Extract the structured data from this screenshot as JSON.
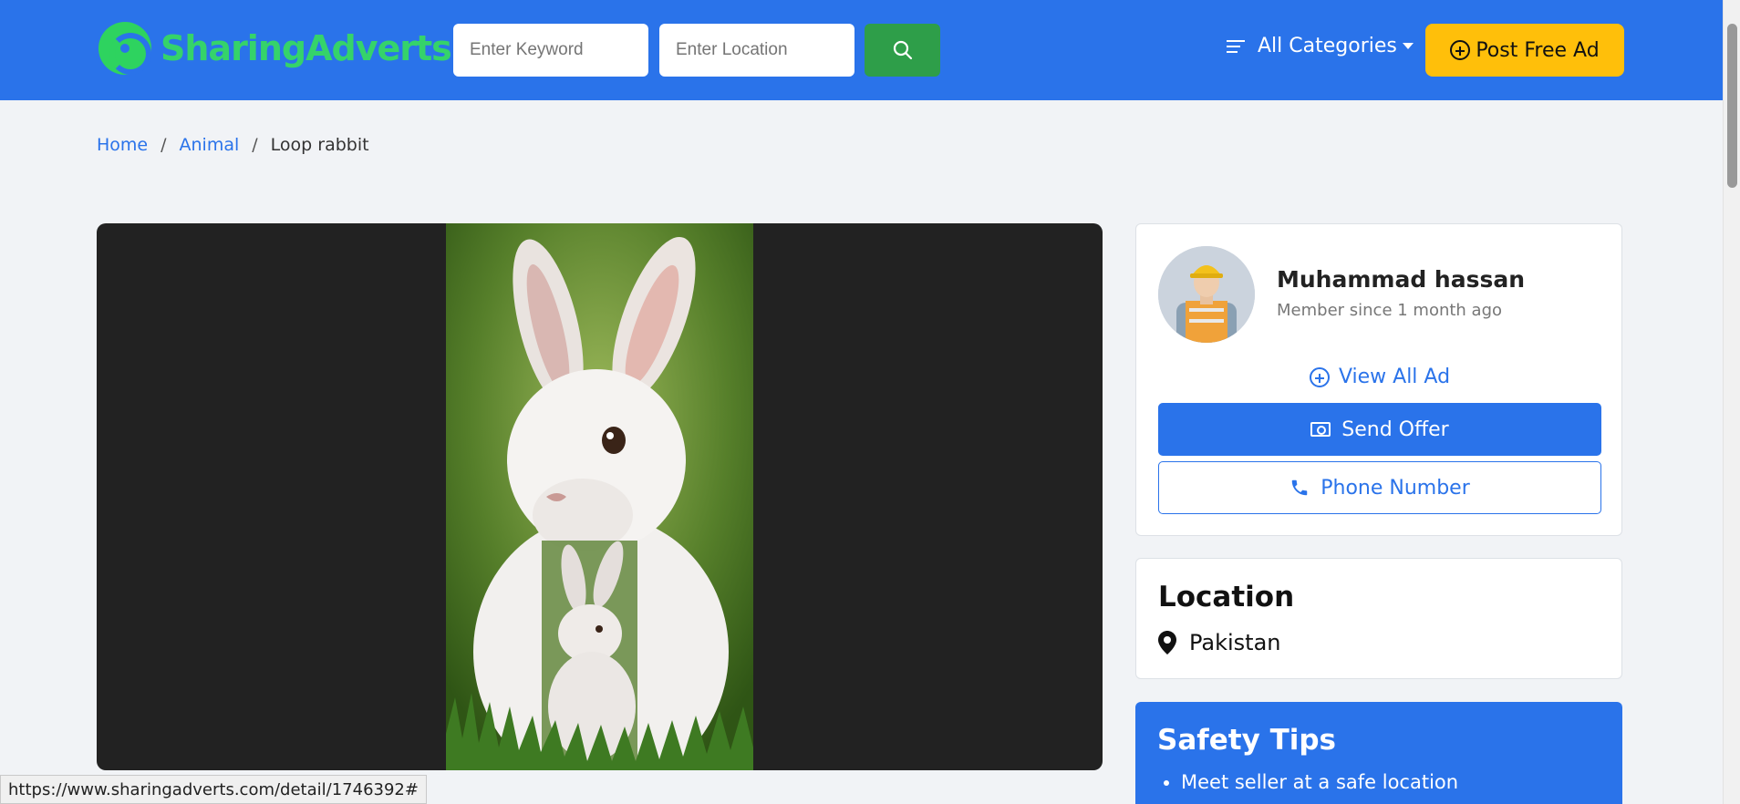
{
  "header": {
    "logo_text": "SharingAdverts",
    "keyword_placeholder": "Enter Keyword",
    "location_placeholder": "Enter Location",
    "categories_label": "All Categories",
    "post_ad_label": "Post Free Ad"
  },
  "breadcrumb": {
    "items": [
      "Home",
      "Animal"
    ],
    "current": "Loop rabbit"
  },
  "seller": {
    "name": "Muhammad hassan",
    "member_since": "Member since 1 month ago",
    "view_all_label": "View All Ad",
    "send_offer_label": "Send Offer",
    "phone_label": "Phone Number"
  },
  "location": {
    "title": "Location",
    "value": "Pakistan"
  },
  "safety": {
    "title": "Safety Tips",
    "tips": [
      "Meet seller at a safe location"
    ]
  },
  "status_bar": {
    "url": "https://www.sharingadverts.com/detail/1746392#"
  },
  "colors": {
    "header_bg": "#2a73ea",
    "logo_green": "#35d36a",
    "search_button": "#2e9e49",
    "post_button": "#ffbf0a",
    "page_bg": "#f1f3f6"
  }
}
